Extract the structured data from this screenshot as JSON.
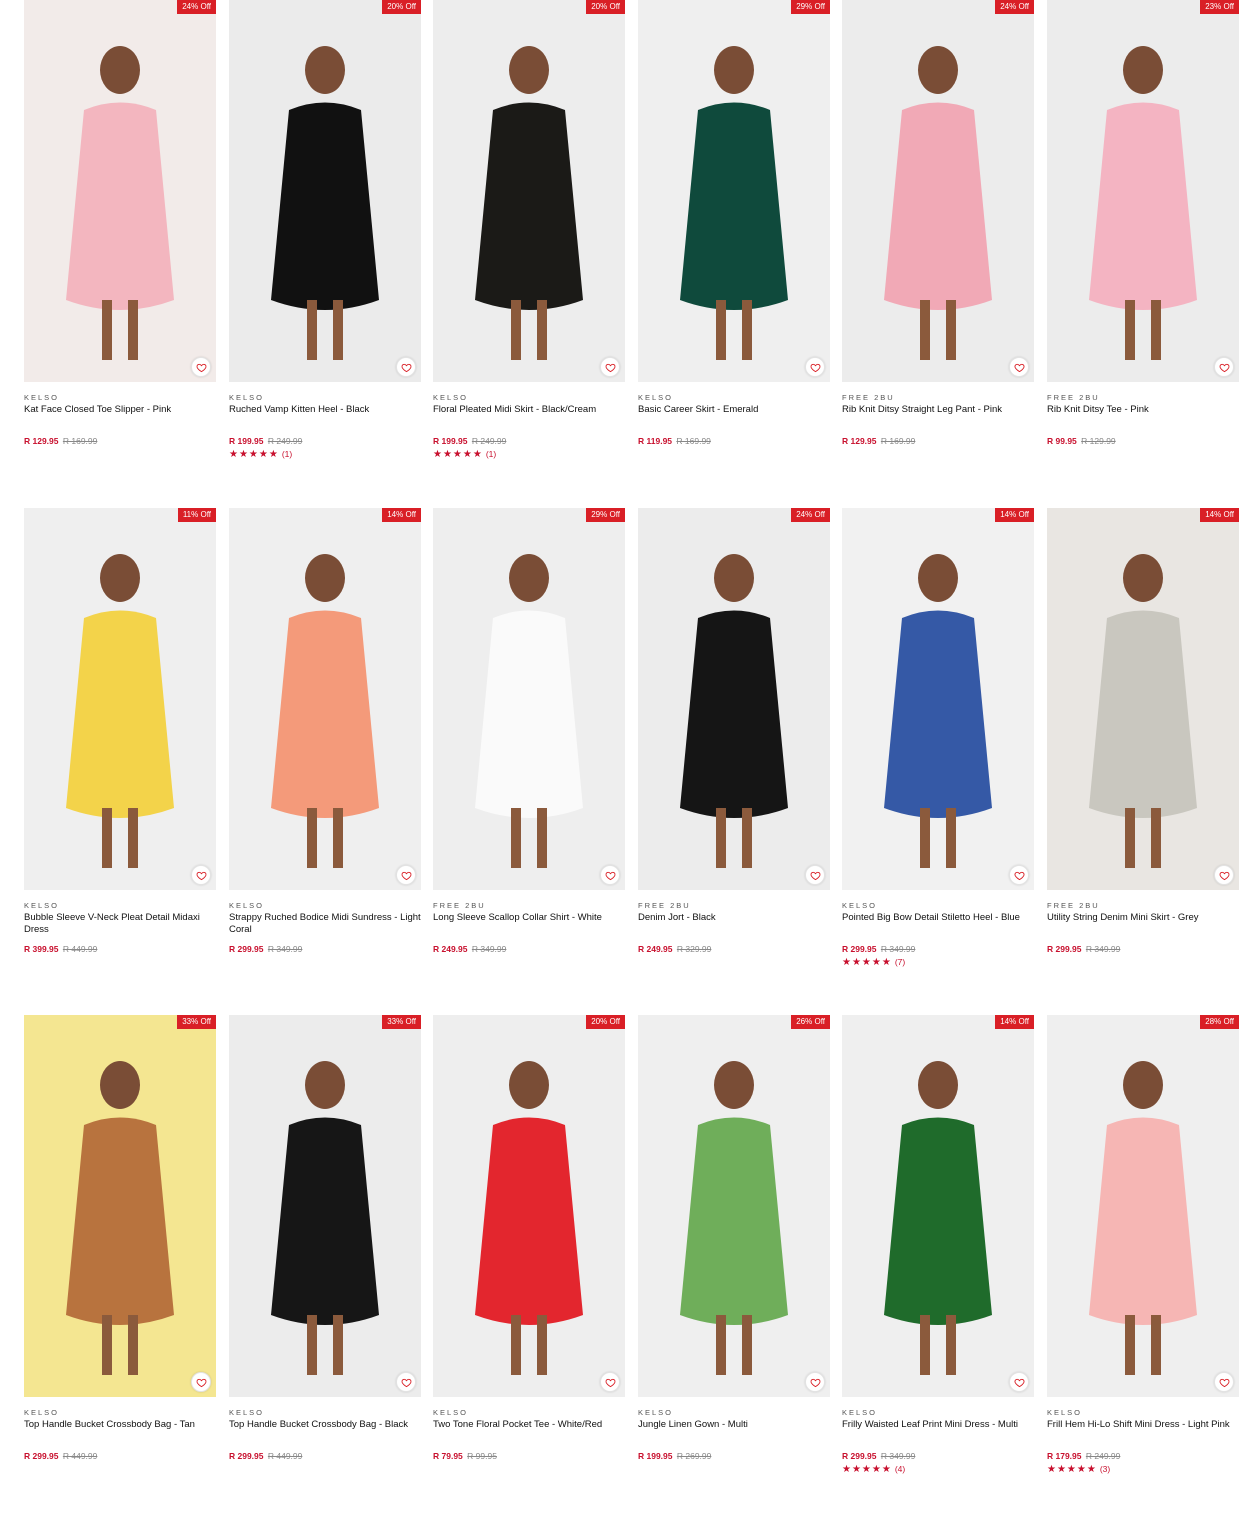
{
  "products": [
    {
      "discount": "24% Off",
      "brand": "KELSO",
      "name": "Kat Face Closed Toe Slipper - Pink",
      "price": "R 129.95",
      "was": "R 169.99",
      "stars": "",
      "reviews": "",
      "bg": "#f2ebe9",
      "item": "#f3b6bf"
    },
    {
      "discount": "20% Off",
      "brand": "KELSO",
      "name": "Ruched Vamp Kitten Heel - Black",
      "price": "R 199.95",
      "was": "R 249.99",
      "stars": "★★★★★",
      "reviews": "(1)",
      "bg": "#ebebeb",
      "item": "#111111"
    },
    {
      "discount": "20% Off",
      "brand": "KELSO",
      "name": "Floral Pleated Midi Skirt - Black/Cream",
      "price": "R 199.95",
      "was": "R 249.99",
      "stars": "★★★★★",
      "reviews": "(1)",
      "bg": "#ededed",
      "item": "#1b1a17"
    },
    {
      "discount": "29% Off",
      "brand": "KELSO",
      "name": "Basic Career Skirt - Emerald",
      "price": "R 119.95",
      "was": "R 169.99",
      "stars": "",
      "reviews": "",
      "bg": "#efefef",
      "item": "#0f4a3c"
    },
    {
      "discount": "24% Off",
      "brand": "FREE 2BU",
      "name": "Rib Knit Ditsy Straight Leg Pant - Pink",
      "price": "R 129.95",
      "was": "R 169.99",
      "stars": "",
      "reviews": "",
      "bg": "#ececec",
      "item": "#f1a9b6"
    },
    {
      "discount": "23% Off",
      "brand": "FREE 2BU",
      "name": "Rib Knit Ditsy Tee - Pink",
      "price": "R 99.95",
      "was": "R 129.99",
      "stars": "",
      "reviews": "",
      "bg": "#ececec",
      "item": "#f4b4c2"
    },
    {
      "discount": "11% Off",
      "brand": "KELSO",
      "name": "Bubble Sleeve V-Neck Pleat Detail Midaxi Dress",
      "price": "R 399.95",
      "was": "R 449.99",
      "stars": "",
      "reviews": "",
      "bg": "#efefef",
      "item": "#f3d34a"
    },
    {
      "discount": "14% Off",
      "brand": "KELSO",
      "name": "Strappy Ruched Bodice Midi Sundress - Light Coral",
      "price": "R 299.95",
      "was": "R 349.99",
      "stars": "",
      "reviews": "",
      "bg": "#efefef",
      "item": "#f49a7a"
    },
    {
      "discount": "29% Off",
      "brand": "FREE 2BU",
      "name": "Long Sleeve Scallop Collar Shirt - White",
      "price": "R 249.95",
      "was": "R 349.99",
      "stars": "",
      "reviews": "",
      "bg": "#eeeeee",
      "item": "#fafafa"
    },
    {
      "discount": "24% Off",
      "brand": "FREE 2BU",
      "name": "Denim Jort - Black",
      "price": "R 249.95",
      "was": "R 329.99",
      "stars": "",
      "reviews": "",
      "bg": "#ececec",
      "item": "#151515"
    },
    {
      "discount": "14% Off",
      "brand": "KELSO",
      "name": "Pointed Big Bow Detail Stiletto Heel - Blue",
      "price": "R 299.95",
      "was": "R 349.99",
      "stars": "★★★★★",
      "reviews": "(7)",
      "bg": "#f1f1f1",
      "item": "#3559a6"
    },
    {
      "discount": "14% Off",
      "brand": "FREE 2BU",
      "name": "Utility String Denim Mini Skirt - Grey",
      "price": "R 299.95",
      "was": "R 349.99",
      "stars": "",
      "reviews": "",
      "bg": "#e9e6e2",
      "item": "#c9c7bf"
    },
    {
      "discount": "33% Off",
      "brand": "KELSO",
      "name": "Top Handle Bucket Crossbody Bag - Tan",
      "price": "R 299.95",
      "was": "R 449.99",
      "stars": "",
      "reviews": "",
      "bg": "#f4e691",
      "item": "#b8733e"
    },
    {
      "discount": "33% Off",
      "brand": "KELSO",
      "name": "Top Handle Bucket Crossbody Bag - Black",
      "price": "R 299.95",
      "was": "R 449.99",
      "stars": "",
      "reviews": "",
      "bg": "#ececec",
      "item": "#161616"
    },
    {
      "discount": "20% Off",
      "brand": "KELSO",
      "name": "Two Tone Floral Pocket Tee - White/Red",
      "price": "R 79.95",
      "was": "R 99.95",
      "stars": "",
      "reviews": "",
      "bg": "#eeeeee",
      "item": "#e3262e"
    },
    {
      "discount": "26% Off",
      "brand": "KELSO",
      "name": "Jungle Linen Gown - Multi",
      "price": "R 199.95",
      "was": "R 269.99",
      "stars": "",
      "reviews": "",
      "bg": "#efefef",
      "item": "#6fae5a"
    },
    {
      "discount": "14% Off",
      "brand": "KELSO",
      "name": "Frilly Waisted Leaf Print Mini Dress - Multi",
      "price": "R 299.95",
      "was": "R 349.99",
      "stars": "★★★★★",
      "reviews": "(4)",
      "bg": "#efefef",
      "item": "#1f6b2b"
    },
    {
      "discount": "28% Off",
      "brand": "KELSO",
      "name": "Frill Hem Hi-Lo Shift Mini Dress - Light Pink",
      "price": "R 179.95",
      "was": "R 249.99",
      "stars": "★★★★★",
      "reviews": "(3)",
      "bg": "#efefef",
      "item": "#f6b6b4"
    }
  ]
}
